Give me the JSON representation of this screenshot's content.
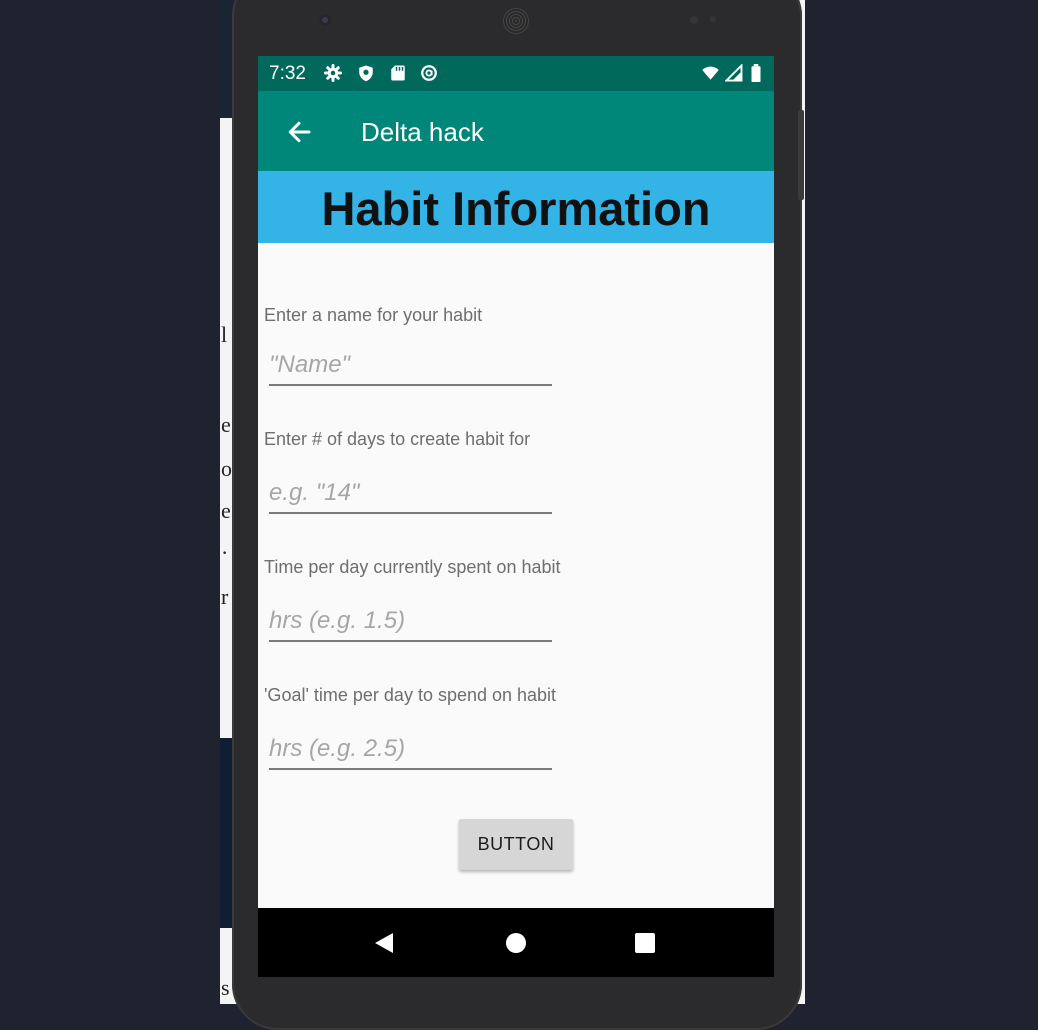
{
  "status_bar": {
    "time": "7:32",
    "left_icons": [
      "gear-icon",
      "shield-icon",
      "sd-card-icon",
      "at-sign-icon"
    ],
    "right_icons": [
      "wifi-icon",
      "signal-icon",
      "battery-icon"
    ]
  },
  "app_bar": {
    "title": "Delta hack",
    "back_icon": "arrow-left-icon",
    "color": "#00877a",
    "status_color": "#00695c"
  },
  "banner": {
    "title": "Habit Information",
    "color": "#34b4e6"
  },
  "form": {
    "fields": [
      {
        "label": "Enter a name for your habit",
        "placeholder": "\"Name\"",
        "value": ""
      },
      {
        "label": "Enter # of days to create habit for",
        "placeholder": "e.g. \"14\"",
        "value": ""
      },
      {
        "label": "Time per day currently spent on habit",
        "placeholder": "hrs (e.g. 1.5)",
        "value": ""
      },
      {
        "label": "'Goal'  time per day to spend on habit",
        "placeholder": "hrs (e.g. 2.5)",
        "value": ""
      }
    ],
    "submit_label": "BUTTON"
  },
  "nav_bar": {
    "icons": [
      "back-triangle-icon",
      "home-circle-icon",
      "recents-square-icon"
    ]
  }
}
